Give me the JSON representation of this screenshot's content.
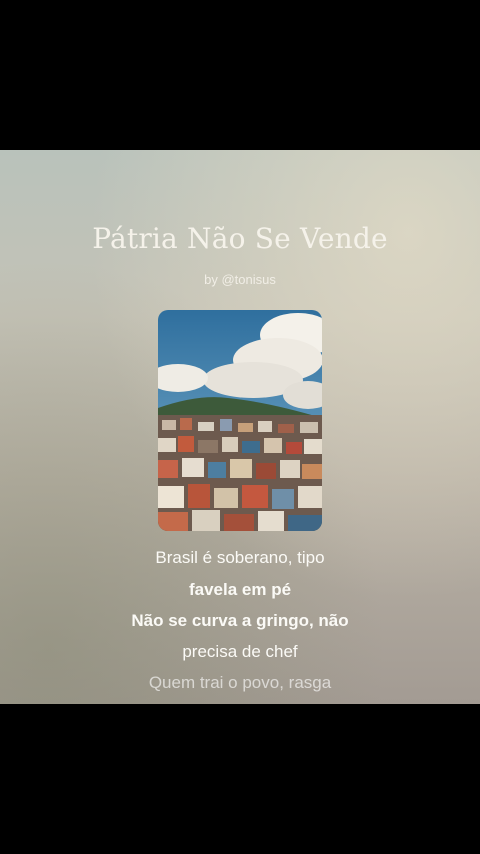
{
  "song": {
    "title": "Pátria Não Se Vende",
    "author": "by @tonisus"
  },
  "cover": {
    "description_icon": "favela-cover-art"
  },
  "lyrics": [
    "Brasil é soberano, tipo",
    "favela em pé",
    "Não se curva a gringo, não",
    "precisa de chef",
    "Quem trai o povo, rasga"
  ],
  "colors": {
    "background": "#000000",
    "text": "#fbfaf6"
  }
}
